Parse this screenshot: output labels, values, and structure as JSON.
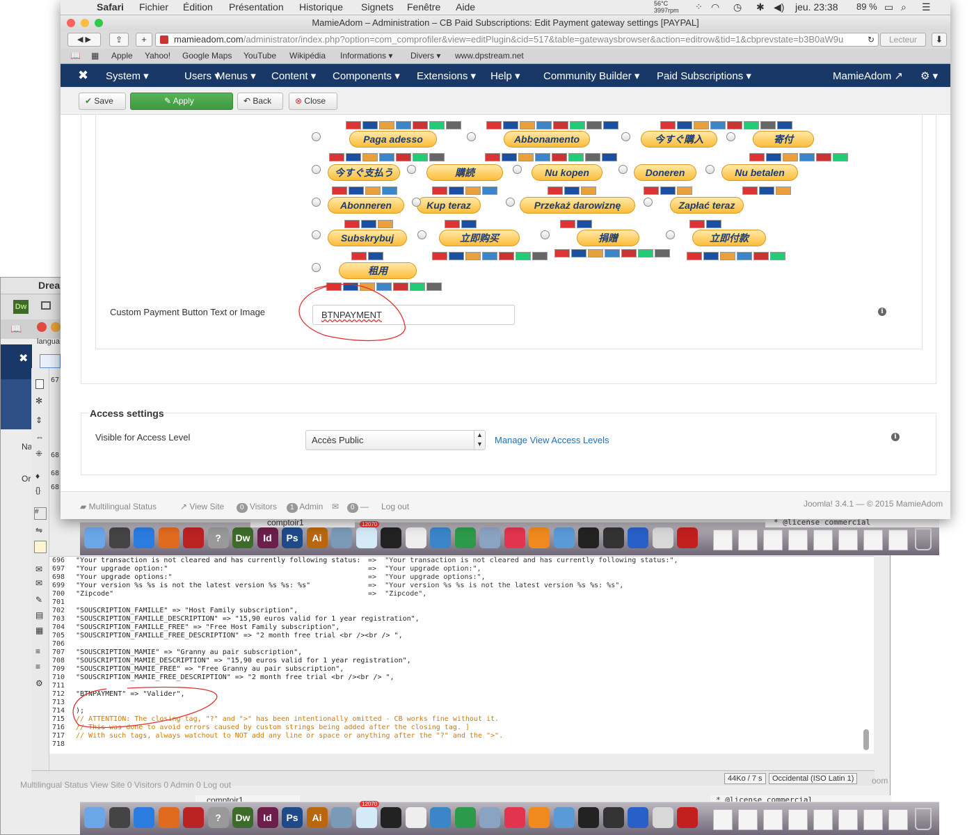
{
  "back_window": {
    "app_label": "Drea",
    "tab_label": "langua",
    "side_labels": [
      "Na",
      "Or"
    ],
    "line_numbers": [
      "67",
      "68",
      "68",
      "68"
    ],
    "code_lines": [
      {
        "n": "696",
        "k": "\"Your transaction is not cleared and has currently following status:",
        "v": "=>  \"Your transaction is not cleared and has currently following status:\","
      },
      {
        "n": "697",
        "k": "\"Your upgrade option:\"",
        "v": "=>  \"Your upgrade option:\","
      },
      {
        "n": "698",
        "k": "\"Your upgrade options:\"",
        "v": "=>  \"Your upgrade options:\","
      },
      {
        "n": "699",
        "k": "\"Your version %s %s is not the latest version %s %s: %s\"",
        "v": "=>  \"Your version %s %s is not the latest version %s %s: %s\","
      },
      {
        "n": "700",
        "k": "\"Zipcode\"",
        "v": "=>  \"Zipcode\","
      },
      {
        "n": "701",
        "k": "",
        "v": ""
      },
      {
        "n": "702",
        "k": "\"SOUSCRIPTION_FAMILLE\" => \"Host Family subscription\",",
        "v": ""
      },
      {
        "n": "703",
        "k": "\"SOUSCRIPTION_FAMILLE_DESCRIPTION\" => \"15,90 euros valid for 1 year registration\",",
        "v": ""
      },
      {
        "n": "704",
        "k": "\"SOUSCRIPTION_FAMILLE_FREE\" => \"Free Host Family subscription\",",
        "v": ""
      },
      {
        "n": "705",
        "k": "\"SOUSCRIPTION_FAMILLE_FREE_DESCRIPTION\" => \"2 month free trial <br /><br /> \",",
        "v": ""
      },
      {
        "n": "706",
        "k": "",
        "v": ""
      },
      {
        "n": "707",
        "k": "\"SOUSCRIPTION_MAMIE\" => \"Granny au pair subscription\",",
        "v": ""
      },
      {
        "n": "708",
        "k": "\"SOUSCRIPTION_MAMIE_DESCRIPTION\" => \"15,90 euros valid for 1 year registration\",",
        "v": ""
      },
      {
        "n": "709",
        "k": "\"SOUSCRIPTION_MAMIE_FREE\" => \"Free Granny au pair subscription\",",
        "v": ""
      },
      {
        "n": "710",
        "k": "\"SOUSCRIPTION_MAMIE_FREE_DESCRIPTION\" => \"2 month free trial <br /><br /> \",",
        "v": ""
      },
      {
        "n": "711",
        "k": "",
        "v": ""
      },
      {
        "n": "712",
        "k": "\"BTNPAYMENT\" => \"Valider\",",
        "v": ""
      },
      {
        "n": "713",
        "k": "",
        "v": ""
      },
      {
        "n": "714",
        "k": ");",
        "v": ""
      }
    ],
    "comment_lines": [
      {
        "n": "715",
        "t": "// ATTENTION: The closing tag, \"?\" and \">\" has been intentionally omitted - CB works fine without it."
      },
      {
        "n": "716",
        "t": "// This was done to avoid errors caused by custom strings being added after the closing tag. ]"
      },
      {
        "n": "717",
        "t": "// With such tags, always watchout to NOT add any line or space or anything after the \"?\" and the \">\"."
      },
      {
        "n": "718",
        "t": ""
      }
    ],
    "status_size": "44Ko / 7 s",
    "status_encoding": "Occidental (ISO Latin 1)",
    "back_footer": "Multilingual Status   View Site   0 Visitors   0 Admin   0   Log out",
    "back_joomla": "oom",
    "comptoir": "comptoir1",
    "license": "* @license commercial"
  },
  "mac_menu": {
    "apple": "",
    "app": "Safari",
    "items": [
      "Fichier",
      "Édition",
      "Présentation",
      "Historique",
      "Signets",
      "Fenêtre",
      "Aide"
    ],
    "temp": "56°C",
    "rpm": "3997rpm",
    "clock": "jeu. 23:38",
    "battery": "89 %"
  },
  "browser": {
    "title": "MamieAdom – Administration – CB Paid Subscriptions: Edit Payment gateway settings [PAYPAL]",
    "url_domain": "mamieadom.com",
    "url_path": "/administrator/index.php?option=com_comprofiler&view=editPlugin&cid=517&table=gatewaysbrowser&action=editrow&tid=1&cbprevstate=b3B0aW9u",
    "reader": "Lecteur",
    "bookmarks": [
      "Apple",
      "Yahoo!",
      "Google Maps",
      "YouTube",
      "Wikipédia",
      "Informations ▾",
      "Divers ▾",
      "www.dpstream.net"
    ]
  },
  "joomla_nav": {
    "items": [
      "System ▾",
      "Users ▾",
      "Menus ▾",
      "Content ▾",
      "Components ▾",
      "Extensions ▾",
      "Help ▾",
      "Community Builder ▾",
      "Paid Subscriptions ▾"
    ],
    "user": "MamieAdom ↗",
    "settings": "⚙ ▾"
  },
  "toolbar": {
    "save": "Save",
    "apply": "Apply",
    "back": "Back",
    "close": "Close"
  },
  "payment_buttons": [
    "Paga adesso",
    "Abbonamento",
    "今すぐ購入",
    "寄付",
    "今すぐ支払う",
    "購読",
    "Nu kopen",
    "Doneren",
    "Nu betalen",
    "Abonneren",
    "Kup teraz",
    "Przekaż darowiznę",
    "Zapłać teraz",
    "Subskrybuj",
    "立即购买",
    "捐贈",
    "立即付款",
    "租用"
  ],
  "custom_label": "Custom Payment Button Text or Image",
  "custom_value": "BTNPAYMENT",
  "access": {
    "legend": "Access settings",
    "label": "Visible for Access Level",
    "select": "Accès Public",
    "link": "Manage View Access Levels"
  },
  "footer": {
    "multilingual": "Multilingual Status",
    "view_site": "View Site",
    "visitors_count": "0",
    "visitors": "Visitors",
    "admin_count": "1",
    "admin": "Admin",
    "mail_count": "0",
    "logout": "Log out",
    "version": "Joomla! 3.4.1  —  © 2015 MamieAdom"
  },
  "dock": {
    "apps": [
      "Finder",
      "Dashboard",
      "Safari",
      "Firefox",
      "FileZilla",
      "?",
      "Dw",
      "Id",
      "Ps",
      "Ai",
      "Preview",
      "Mail",
      "Terminal",
      "TextEdit",
      "Wireless",
      "Network",
      "Utility",
      "iTunes",
      "iBooks",
      "Simulator",
      "Activity",
      "Star",
      "Vectorworks",
      "Preview2",
      "Acrobat"
    ],
    "mail_badge": "12070"
  },
  "colors": {
    "nav": "#1a3867",
    "apply": "#46a546",
    "link": "#1f6fb2",
    "annotation": "#e0302f"
  }
}
